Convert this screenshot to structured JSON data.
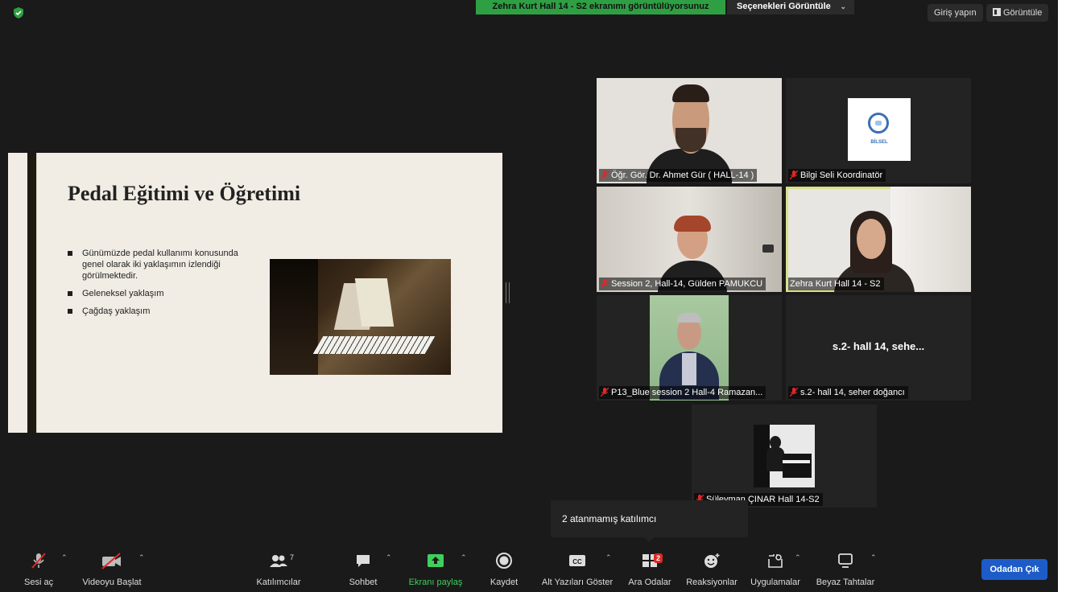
{
  "topbar": {
    "share_banner": "Zehra Kurt Hall 14 - S2 ekranımı görüntülüyorsunuz",
    "view_options": "Seçenekleri Görüntüle",
    "signin": "Giriş yapın",
    "view": "Görüntüle"
  },
  "slide": {
    "title": "Pedal Eğitimi ve Öğretimi",
    "bullets": [
      "Günümüzde pedal kullanımı konusunda genel olarak iki yaklaşımın izlendiği görülmektedir.",
      "Geleneksel yaklaşım",
      "Çağdaş yaklaşım"
    ]
  },
  "participants": [
    {
      "name": "Öğr. Gör. Dr. Ahmet Gür ( HALL-14 )"
    },
    {
      "name": "Bilgi Seli Koordinatör",
      "logo_text": "BİLSEL"
    },
    {
      "name": "Session 2, Hall-14, Gülden PAMUKCU"
    },
    {
      "name": "Zehra Kurt Hall 14 - S2"
    },
    {
      "name": "P13_Blue session 2 Hall-4 Ramazan..."
    },
    {
      "name": "s.2- hall 14, seher doğancı",
      "display": "s.2- hall 14, sehe..."
    },
    {
      "name": "Süleyman ÇINAR Hall 14-S2"
    }
  ],
  "tooltip": "2 atanmamış katılımcı",
  "toolbar": {
    "mute": "Sesi aç",
    "video": "Videoyu Başlat",
    "participants": "Katılımcılar",
    "participants_count": "7",
    "chat": "Sohbet",
    "share": "Ekranı paylaş",
    "record": "Kaydet",
    "cc_icon": "CC",
    "captions": "Alt Yazıları Göster",
    "breakout": "Ara Odalar",
    "breakout_badge": "2",
    "reactions": "Reaksiyonlar",
    "apps": "Uygulamalar",
    "whiteboard": "Beyaz Tahtalar",
    "leave": "Odadan Çık"
  },
  "colors": {
    "accent_green": "#2ea043",
    "leave_blue": "#1d5cc8",
    "active_speaker": "#d9e08a",
    "muted_red": "#e02828"
  }
}
